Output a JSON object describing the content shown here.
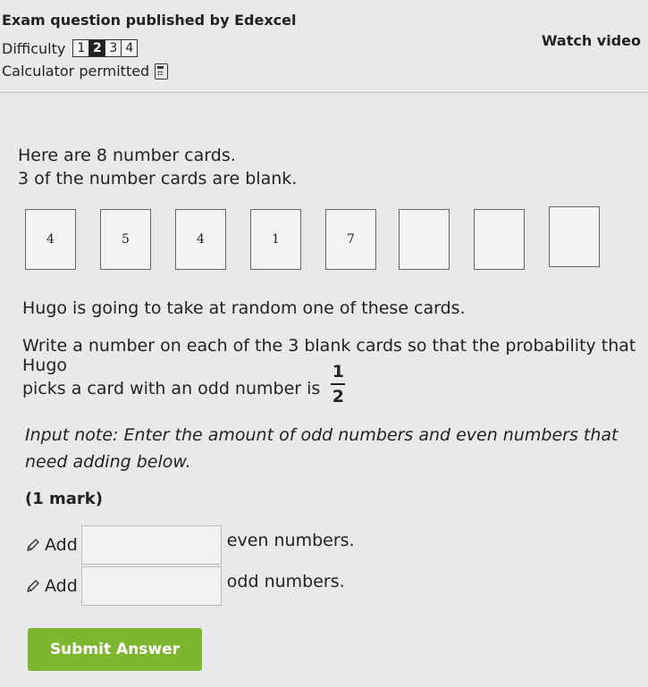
{
  "header": {
    "title": "Exam question published by Edexcel",
    "difficulty_label": "Difficulty",
    "difficulty_levels": [
      "1",
      "2",
      "3",
      "4"
    ],
    "difficulty_selected": "2",
    "calculator_label": "Calculator permitted",
    "watch_video": "Watch video"
  },
  "question": {
    "intro_line1": "Here are 8 number cards.",
    "intro_line2": "3 of the number cards are blank.",
    "cards": [
      "4",
      "5",
      "4",
      "1",
      "7",
      "",
      "",
      ""
    ],
    "prompt_line1": "Hugo is going to take at random one of these cards.",
    "prompt_line2a": "Write a number on each of the 3 blank cards so that the probability that Hugo",
    "prompt_line2b": "picks a card with an odd number is",
    "fraction_numerator": "1",
    "fraction_denominator": "2",
    "input_note": "Input note: Enter the amount of odd numbers and even numbers that need adding below.",
    "marks": "(1 mark)"
  },
  "answers": {
    "row1_prefix": "Add",
    "row1_value": "",
    "row1_suffix": "even numbers.",
    "row2_prefix": "Add",
    "row2_value": "",
    "row2_suffix": "odd numbers."
  },
  "submit_label": "Submit Answer"
}
